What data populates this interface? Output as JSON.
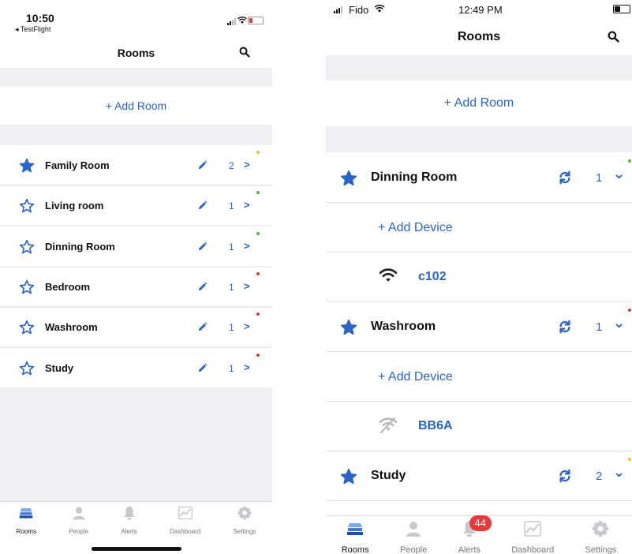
{
  "colors": {
    "accent": "#2b64c6",
    "dot_yellow": "#f2c21a",
    "dot_green": "#5bb33b",
    "dot_red": "#d93a3a",
    "badge": "#e83a3a"
  },
  "left": {
    "status": {
      "time": "10:50",
      "back": "◂ TestFlight"
    },
    "nav": {
      "title": "Rooms",
      "search_icon": "search-icon"
    },
    "add_room": "+ Add Room",
    "rooms": [
      {
        "name": "Family Room",
        "count": "2",
        "chevron": ">",
        "starred": true,
        "dot": "yellow"
      },
      {
        "name": "Living room",
        "count": "1",
        "chevron": ">",
        "starred": false,
        "dot": "green"
      },
      {
        "name": "Dinning Room",
        "count": "1",
        "chevron": ">",
        "starred": false,
        "dot": "green"
      },
      {
        "name": "Bedroom",
        "count": "1",
        "chevron": ">",
        "starred": false,
        "dot": "red"
      },
      {
        "name": "Washroom",
        "count": "1",
        "chevron": ">",
        "starred": false,
        "dot": "red"
      },
      {
        "name": "Study",
        "count": "1",
        "chevron": ">",
        "starred": false,
        "dot": "red"
      }
    ],
    "tabs": [
      {
        "label": "Rooms",
        "icon": "rooms-icon",
        "active": true
      },
      {
        "label": "People",
        "icon": "people-icon",
        "active": false
      },
      {
        "label": "Alerts",
        "icon": "bell-icon",
        "active": false
      },
      {
        "label": "Dashboard",
        "icon": "chart-icon",
        "active": false
      },
      {
        "label": "Settings",
        "icon": "gear-icon",
        "active": false
      }
    ]
  },
  "right": {
    "status": {
      "carrier": "Fido",
      "time": "12:49 PM"
    },
    "nav": {
      "title": "Rooms",
      "search_icon": "search-icon"
    },
    "add_room": "+ Add Room",
    "rooms": [
      {
        "name": "Dinning Room",
        "count": "1",
        "chevron": "⌄",
        "dot": "green",
        "add_device": "+ Add Device",
        "devices": [
          {
            "name": "c102",
            "icon": "wifi-icon",
            "online": true
          }
        ]
      },
      {
        "name": "Washroom",
        "count": "1",
        "chevron": "⌄",
        "dot": "red",
        "add_device": "+ Add Device",
        "devices": [
          {
            "name": "BB6A",
            "icon": "wifi-off-icon",
            "online": false
          }
        ]
      },
      {
        "name": "Study",
        "count": "2",
        "chevron": "⌄",
        "dot": "yellow"
      }
    ],
    "tabs": [
      {
        "label": "Rooms",
        "icon": "rooms-icon",
        "active": true
      },
      {
        "label": "People",
        "icon": "people-icon",
        "active": false
      },
      {
        "label": "Alerts",
        "icon": "bell-icon",
        "active": false,
        "badge": "44"
      },
      {
        "label": "Dashboard",
        "icon": "chart-icon",
        "active": false
      },
      {
        "label": "Settings",
        "icon": "gear-icon",
        "active": false
      }
    ]
  }
}
